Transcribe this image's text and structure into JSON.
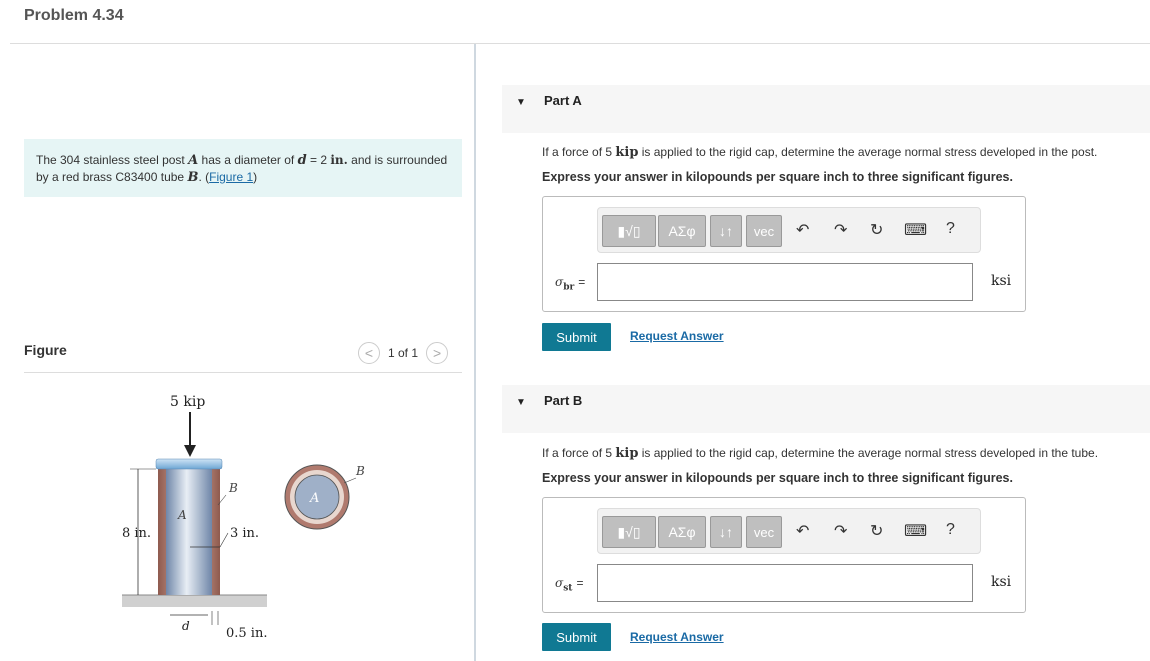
{
  "problem": {
    "title": "Problem 4.34",
    "text_1": "The 304 stainless steel post ",
    "var_post": "A",
    "text_2": " has a diameter of ",
    "var_d": "d",
    "text_3": " = 2 ",
    "unit_in": "in.",
    "text_4": " and is surrounded by a red brass C83400 tube ",
    "var_tube": "B",
    "text_5": ". (",
    "figure_link": "Figure 1",
    "text_6": ")"
  },
  "figure": {
    "label": "Figure",
    "pager_text": "1 of 1",
    "prev_symbol": "<",
    "next_symbol": ">",
    "labels": {
      "force": "5 kip",
      "height": "8 in.",
      "post": "A",
      "tube": "B",
      "radius": "3 in.",
      "diameter": "d",
      "thickness": "0.5 in.",
      "section_post": "A",
      "section_tube": "B"
    }
  },
  "toolbar": {
    "templates": "▮√▯",
    "greek": "ΑΣφ",
    "arrows": "↓↑",
    "vec": "vec",
    "undo": "↶",
    "redo": "↷",
    "reset": "↻",
    "keyboard": "⌨",
    "help": "?"
  },
  "part_a": {
    "label": "Part A",
    "collapse_symbol": "▼",
    "question_1": "If a force of 5 ",
    "question_kip": "kip",
    "question_2": " is applied to the rigid cap, determine the average normal stress developed in the post.",
    "instruction": "Express your answer in kilopounds per square inch to three significant figures.",
    "var_symbol": "σ",
    "var_sub": "br",
    "equals": "=",
    "input_value": "",
    "unit": "ksi",
    "submit_label": "Submit",
    "request_label": "Request Answer"
  },
  "part_b": {
    "label": "Part B",
    "collapse_symbol": "▼",
    "question_1": "If a force of 5 ",
    "question_kip": "kip",
    "question_2": " is applied to the rigid cap, determine the average normal stress developed in the tube.",
    "instruction": "Express your answer in kilopounds per square inch to three significant figures.",
    "var_symbol": "σ",
    "var_sub": "st",
    "equals": "=",
    "input_value": "",
    "unit": "ksi",
    "submit_label": "Submit",
    "request_label": "Request Answer"
  },
  "colors": {
    "accent": "#107993",
    "link": "#1a6aa5",
    "problem_bg": "#e6f5f5",
    "tube": "#c08878",
    "post": "#8fa4bf"
  }
}
